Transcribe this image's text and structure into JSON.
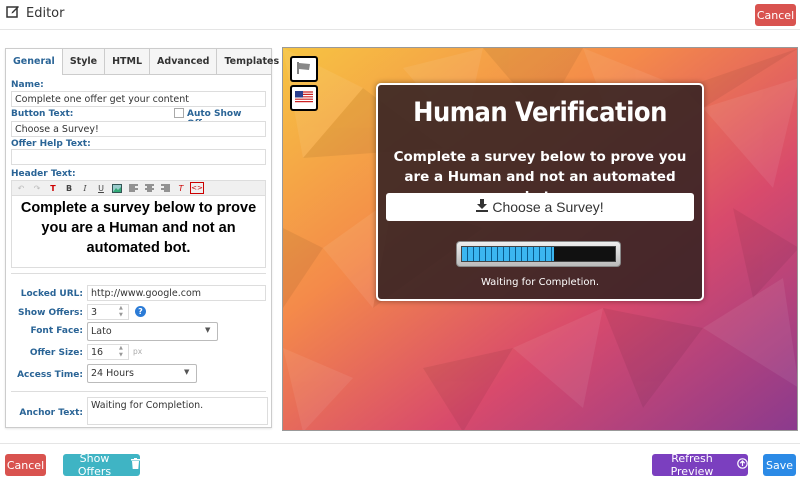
{
  "header": {
    "title": "Editor",
    "cancel_label": "Cancel"
  },
  "tabs": [
    "General",
    "Style",
    "HTML",
    "Advanced",
    "Templates"
  ],
  "form": {
    "name_label": "Name:",
    "name_value": "Complete one offer get your content",
    "button_text_label": "Button Text:",
    "auto_show_label": "Auto Show Offers",
    "button_text_value": "Choose a Survey!",
    "offer_help_label": "Offer Help Text:",
    "offer_help_value": "",
    "header_text_label": "Header Text:",
    "header_text_value": "Complete a survey below to prove you are a Human and not an automated bot.",
    "locked_url_label": "Locked URL:",
    "locked_url_value": "http://www.google.com",
    "show_offers_label": "Show Offers:",
    "show_offers_value": "3",
    "font_face_label": "Font Face:",
    "font_face_value": "Lato",
    "offer_size_label": "Offer Size:",
    "offer_size_value": "16",
    "offer_size_unit": "px",
    "access_time_label": "Access Time:",
    "access_time_value": "24 Hours",
    "anchor_text_label": "Anchor Text:",
    "anchor_text_value": "Waiting for Completion."
  },
  "preview": {
    "title": "Human Verification",
    "subtitle": "Complete a survey below to prove you are a Human and not an automated bot.",
    "button_label": "Choose a Survey!",
    "progress": 0.6,
    "anchor_text": "Waiting for Completion."
  },
  "footer": {
    "cancel_label": "Cancel",
    "show_offers_label": "Show Offers",
    "refresh_label": "Refresh Preview",
    "save_label": "Save"
  },
  "colors": {
    "cancel": "#d9534f",
    "show_offers": "#3fb4c4",
    "refresh": "#7b3fbf",
    "save": "#2b8ae6",
    "link_blue": "#2a6496"
  }
}
